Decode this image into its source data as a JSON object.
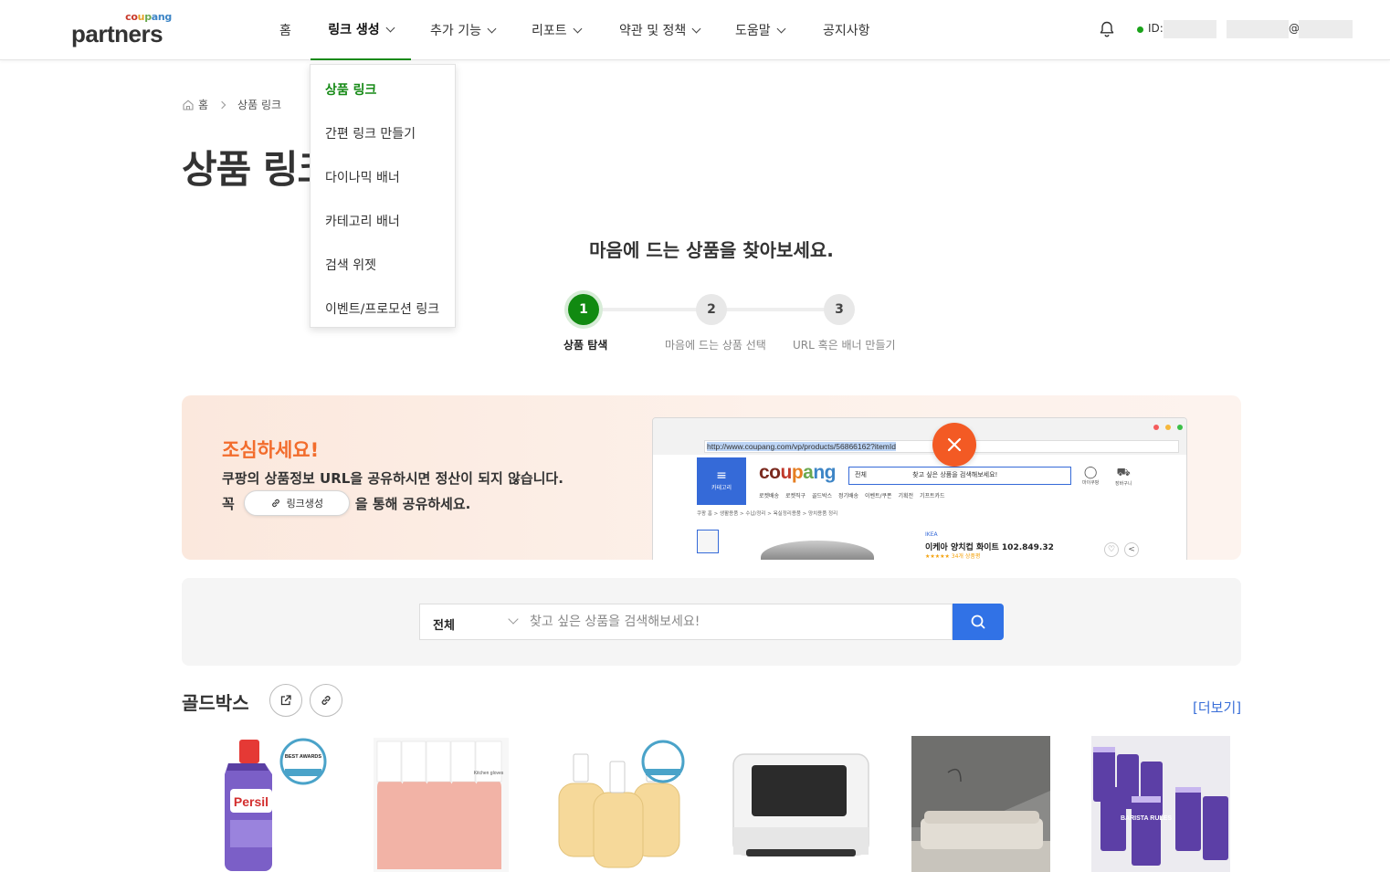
{
  "header": {
    "logo_small": "coupang",
    "logo_big": "partners",
    "nav": [
      {
        "label": "홈"
      },
      {
        "label": "링크 생성"
      },
      {
        "label": "추가 기능"
      },
      {
        "label": "리포트"
      },
      {
        "label": "약관 및 정책"
      },
      {
        "label": "도움말"
      },
      {
        "label": "공지사항"
      }
    ],
    "id_label": "ID:",
    "email_at": "@"
  },
  "dropdown": {
    "items": [
      {
        "label": "상품 링크"
      },
      {
        "label": "간편 링크 만들기"
      },
      {
        "label": "다이나믹 배너"
      },
      {
        "label": "카테고리 배너"
      },
      {
        "label": "검색 위젯"
      },
      {
        "label": "이벤트/프로모션 링크"
      }
    ]
  },
  "breadcrumb": {
    "home": "홈",
    "current": "상품 링크"
  },
  "page_title": "상품 링크",
  "steps": {
    "title": "마음에 드는 상품을 찾아보세요.",
    "items": [
      {
        "number": "1",
        "label": "상품 탐색"
      },
      {
        "number": "2",
        "label": "마음에 드는 상품 선택"
      },
      {
        "number": "3",
        "label": "URL 혹은 배너 만들기"
      }
    ]
  },
  "banner": {
    "title": "조심하세요!",
    "line1": "쿠팡의 상품정보 URL을 공유하시면 정산이 되지 않습니다.",
    "line2_prefix": "꼭",
    "pill_label": "링크생성",
    "line2_suffix": "을 통해 공유하세요.",
    "mock": {
      "url": "http://www.coupang.com/vp/products/56866162?itemId",
      "category_label": "카테고리",
      "logo": "coupang",
      "search_category": "전체",
      "search_placeholder": "찾고 싶은 상품을 검색해보세요!",
      "menu": "로켓배송 로켓직구 골드박스 정기배송 이벤트/쿠폰 기획전 기프트카드",
      "breadcrumb": "쿠팡 홈 > 생활용품 > 수납/정리 > 욕실정리용품 > 양치용품 정리",
      "brand": "IKEA",
      "product_name": "이케아 양치컵 화이트 102.849.32",
      "rating": "★★★★★ 34개 상품평",
      "icon_mypage": "마이쿠팡",
      "icon_cart": "장바구니"
    },
    "accent": "#f26c2c"
  },
  "search": {
    "category": "전체",
    "placeholder": "찾고 싶은 상품을 검색해보세요!"
  },
  "goldbox": {
    "title": "골드박스",
    "more_label": "[더보기]",
    "products": [
      {
        "name": "persil-detergent",
        "brand_text": "Persil",
        "award": "BEST AWARDS"
      },
      {
        "name": "kitchen-gloves",
        "brand_text": "Kitchen gloves"
      },
      {
        "name": "hand-soap"
      },
      {
        "name": "oven-toaster"
      },
      {
        "name": "sofa-interior"
      },
      {
        "name": "barista-rules-coffee",
        "brand_text": "BARISTA RULES"
      }
    ]
  },
  "colors": {
    "brand_green": "#118a11",
    "primary_blue": "#3172e6",
    "warning_orange": "#f35a24"
  }
}
